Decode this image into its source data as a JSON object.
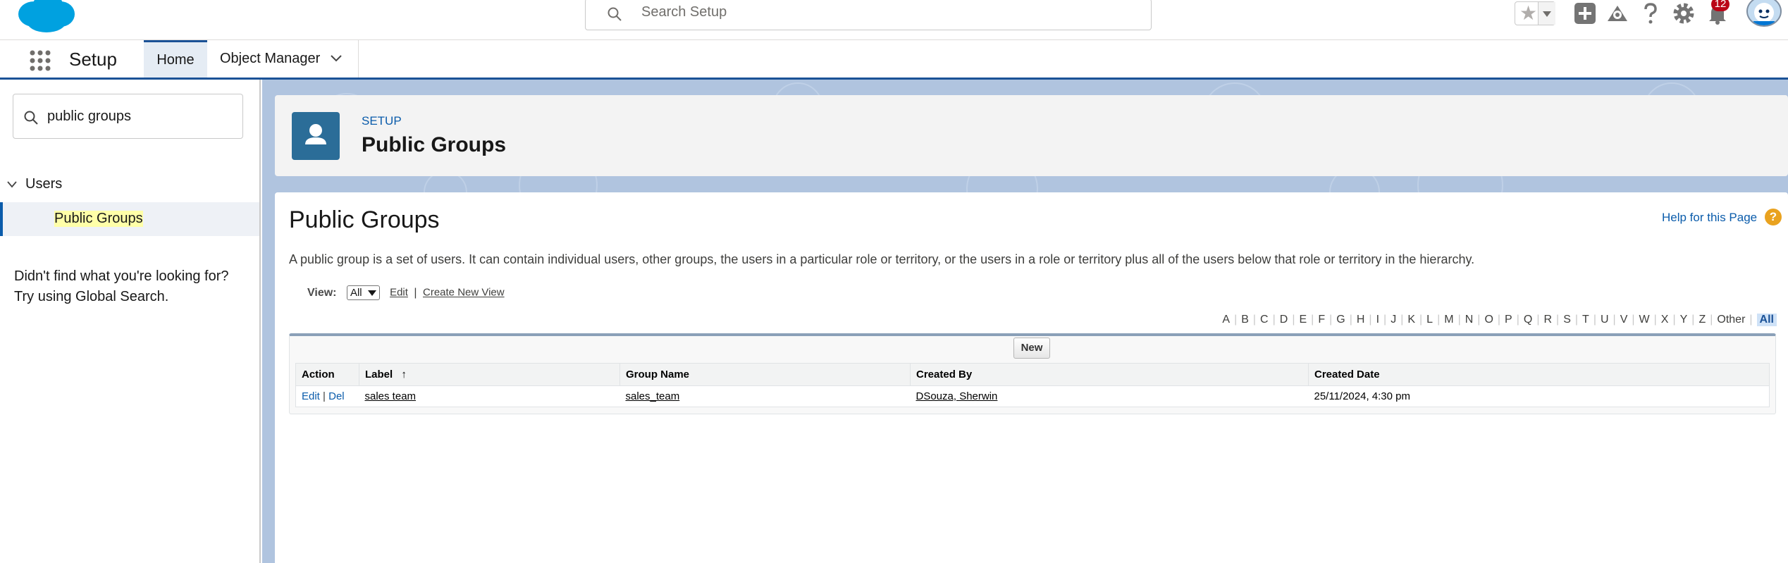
{
  "header": {
    "search_placeholder": "Search Setup",
    "notification_count": "12"
  },
  "nav": {
    "app_name": "Setup",
    "tabs": [
      {
        "label": "Home",
        "active": true
      },
      {
        "label": "Object Manager",
        "active": false
      }
    ]
  },
  "sidebar": {
    "quick_find_value": "public groups",
    "tree": {
      "parent": "Users",
      "child": "Public Groups"
    },
    "not_found_line1": "Didn't find what you're looking for?",
    "not_found_line2": "Try using Global Search."
  },
  "page_header": {
    "eyebrow": "SETUP",
    "title": "Public Groups"
  },
  "content": {
    "title": "Public Groups",
    "help_link": "Help for this Page",
    "help_icon": "?",
    "description": "A public group is a set of users. It can contain individual users, other groups, the users in a particular role or territory, or the users in a role or territory plus all of the users below that role or territory in the hierarchy.",
    "view_label": "View:",
    "view_selected": "All",
    "edit_link": "Edit",
    "separator": "|",
    "create_view_link": "Create New View",
    "alpha_filter": [
      "A",
      "B",
      "C",
      "D",
      "E",
      "F",
      "G",
      "H",
      "I",
      "J",
      "K",
      "L",
      "M",
      "N",
      "O",
      "P",
      "Q",
      "R",
      "S",
      "T",
      "U",
      "V",
      "W",
      "X",
      "Y",
      "Z",
      "Other",
      "All"
    ],
    "alpha_selected": "All",
    "new_button": "New"
  },
  "table": {
    "columns": [
      "Action",
      "Label",
      "Group Name",
      "Created By",
      "Created Date"
    ],
    "sort_indicator": "↑",
    "rows": [
      {
        "action_edit": "Edit",
        "action_sep": "|",
        "action_del": "Del",
        "label": "sales team",
        "group_name": "sales_team",
        "created_by": "DSouza, Sherwin",
        "created_date": "25/11/2024, 4:30 pm"
      }
    ]
  },
  "icons": {
    "logo": "salesforce-cloud-icon",
    "search": "search-icon",
    "favorites": "star-icon",
    "add": "plus-icon",
    "trailhead": "trailhead-icon",
    "help": "question-icon",
    "settings": "gear-icon",
    "notifications": "bell-icon",
    "app_launcher": "waffle-icon",
    "page_icon": "user-icon"
  },
  "colors": {
    "brand_blue": "#0b5cab",
    "logo_blue": "#00a1e0",
    "nav_accent": "#1b5297",
    "page_icon_bg": "#2b6d98",
    "badge_red": "#ba0517",
    "highlight": "#ffffa8"
  }
}
